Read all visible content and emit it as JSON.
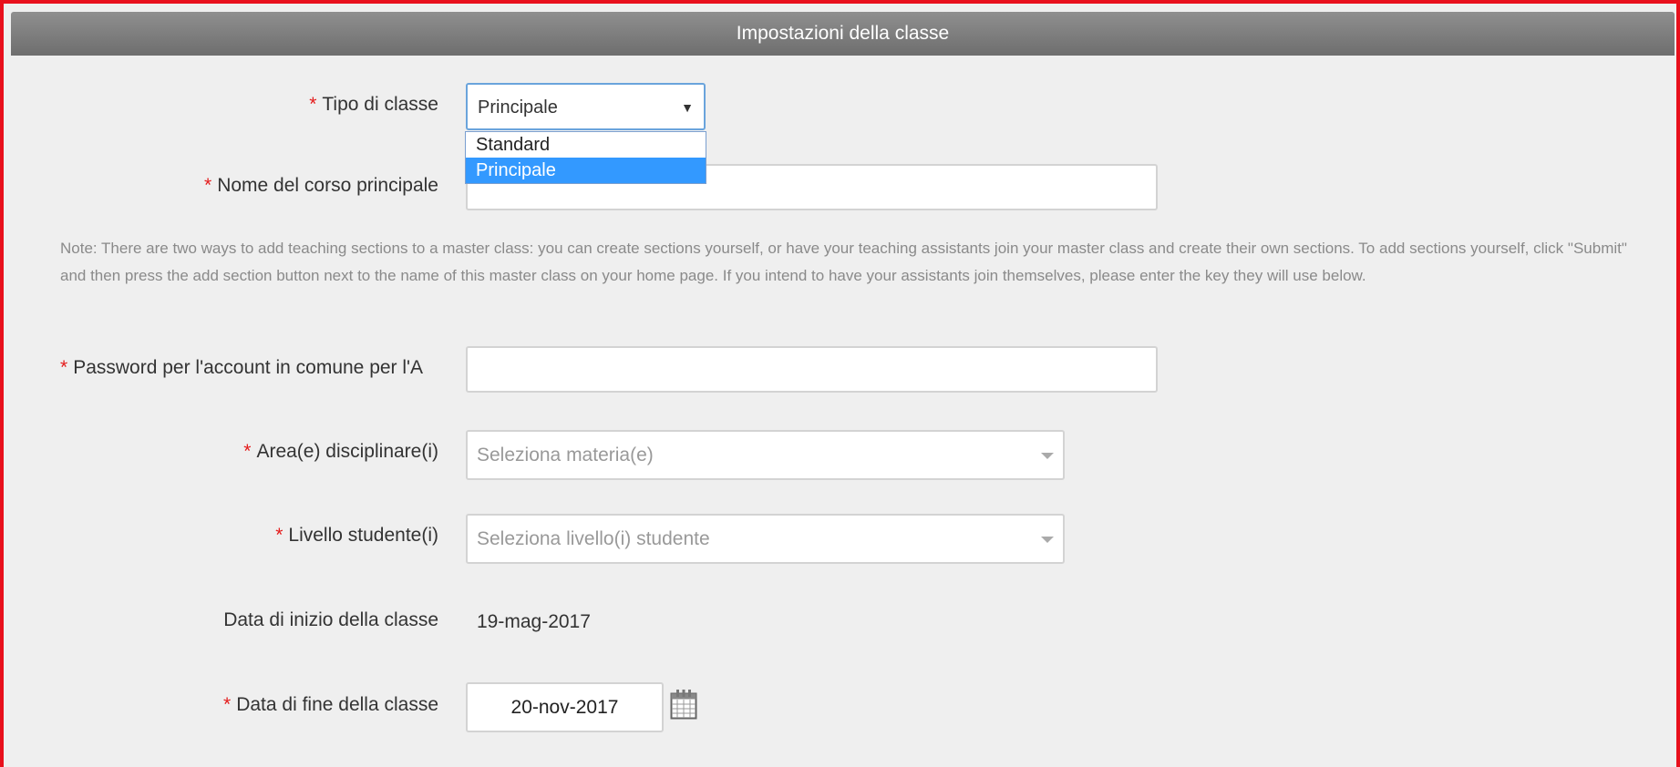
{
  "header": {
    "title": "Impostazioni della classe"
  },
  "form": {
    "class_type": {
      "label": "Tipo di classe",
      "value": "Principale",
      "options": [
        "Standard",
        "Principale"
      ]
    },
    "course_name": {
      "label": "Nome del corso principale",
      "value": ""
    },
    "note": "Note: There are two ways to add teaching sections to a master class: you can create sections yourself, or have your teaching assistants join your master class and create their own sections. To add sections yourself, click \"Submit\" and then press the add section button next to the name of this master class on your home page. If you intend to have your assistants join themselves, please enter the key they will use below.",
    "password": {
      "label": "Password per l'account in comune per l'A",
      "value": ""
    },
    "subject_area": {
      "label": "Area(e) disciplinare(i)",
      "placeholder": "Seleziona materia(e)"
    },
    "student_level": {
      "label": "Livello studente(i)",
      "placeholder": "Seleziona livello(i) studente"
    },
    "start_date": {
      "label": "Data di inizio della classe",
      "value": "19-mag-2017"
    },
    "end_date": {
      "label": "Data di fine della classe",
      "value": "20-nov-2017"
    }
  },
  "required_mark": "*",
  "colors": {
    "required": "#e41b1b",
    "selected_option": "#3399ff",
    "frame": "#e8101c"
  }
}
